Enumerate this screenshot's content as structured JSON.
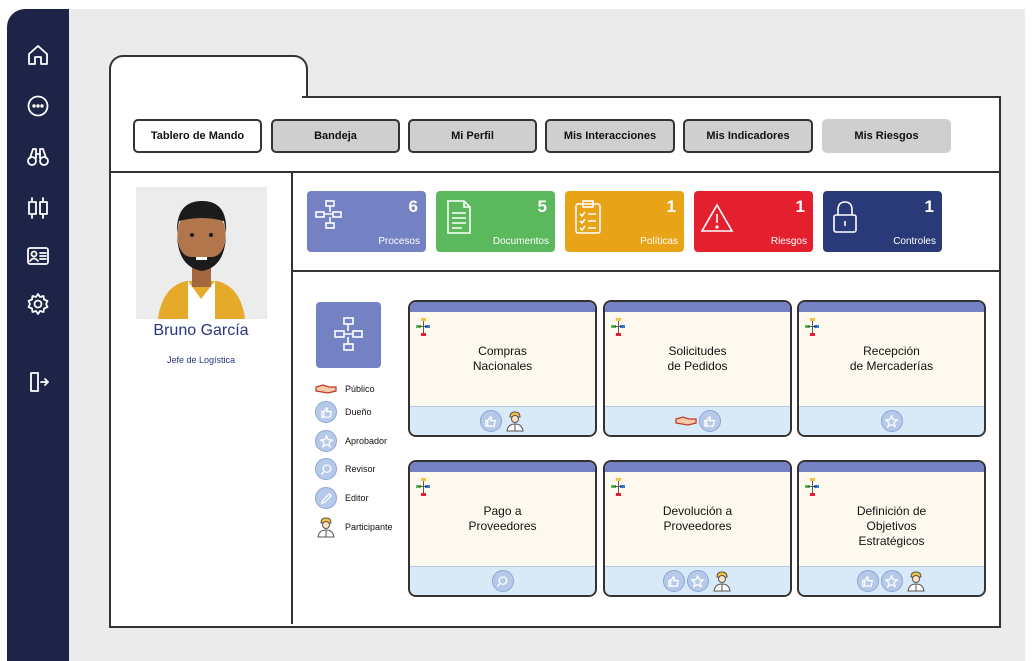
{
  "sidebar": {
    "icons": [
      "home-icon",
      "more-icon",
      "binoculars-icon",
      "sync-icon",
      "id-card-icon",
      "gear-icon",
      "logout-icon"
    ]
  },
  "tabs": [
    {
      "label": "Tablero de Mando",
      "active": true
    },
    {
      "label": "Bandeja",
      "active": false
    },
    {
      "label": "Mi Perfil",
      "active": false
    },
    {
      "label": "Mis Interacciones",
      "active": false
    },
    {
      "label": "Mis Indicadores",
      "active": false
    },
    {
      "label": "Mis Riesgos",
      "active": false
    }
  ],
  "profile": {
    "name": "Bruno García",
    "role": "Jefe de Logística"
  },
  "kpis": [
    {
      "count": "6",
      "label": "Procesos",
      "color": "#7482c4",
      "icon": "flowchart-icon"
    },
    {
      "count": "5",
      "label": "Documentos",
      "color": "#5cb85c",
      "icon": "document-icon"
    },
    {
      "count": "1",
      "label": "Políticas",
      "color": "#e8a317",
      "icon": "checklist-icon"
    },
    {
      "count": "1",
      "label": "Riesgos",
      "color": "#e4202e",
      "icon": "warning-icon"
    },
    {
      "count": "1",
      "label": "Controles",
      "color": "#2a3a78",
      "icon": "lock-icon"
    }
  ],
  "legend": [
    {
      "label": "Público",
      "icon": "handshake-icon"
    },
    {
      "label": "Dueño",
      "icon": "thumbs-up-icon"
    },
    {
      "label": "Aprobador",
      "icon": "star-icon"
    },
    {
      "label": "Revisor",
      "icon": "magnifier-icon"
    },
    {
      "label": "Editor",
      "icon": "pencil-icon"
    },
    {
      "label": "Participante",
      "icon": "worker-icon"
    }
  ],
  "processes": [
    {
      "title": "Compras\nNacionales",
      "roles": [
        "thumbs-up-icon",
        "worker-icon"
      ]
    },
    {
      "title": "Solicitudes\nde Pedidos",
      "roles": [
        "handshake-icon",
        "thumbs-up-icon"
      ]
    },
    {
      "title": "Recepción\nde Mercaderías",
      "roles": [
        "star-icon"
      ]
    },
    {
      "title": "Pago a\nProveedores",
      "roles": [
        "magnifier-icon"
      ]
    },
    {
      "title": "Devolución a\nProveedores",
      "roles": [
        "thumbs-up-icon",
        "star-icon",
        "worker-icon"
      ]
    },
    {
      "title": "Definición de\nObjetivos\nEstratégicos",
      "roles": [
        "thumbs-up-icon",
        "star-icon",
        "worker-icon"
      ]
    }
  ]
}
